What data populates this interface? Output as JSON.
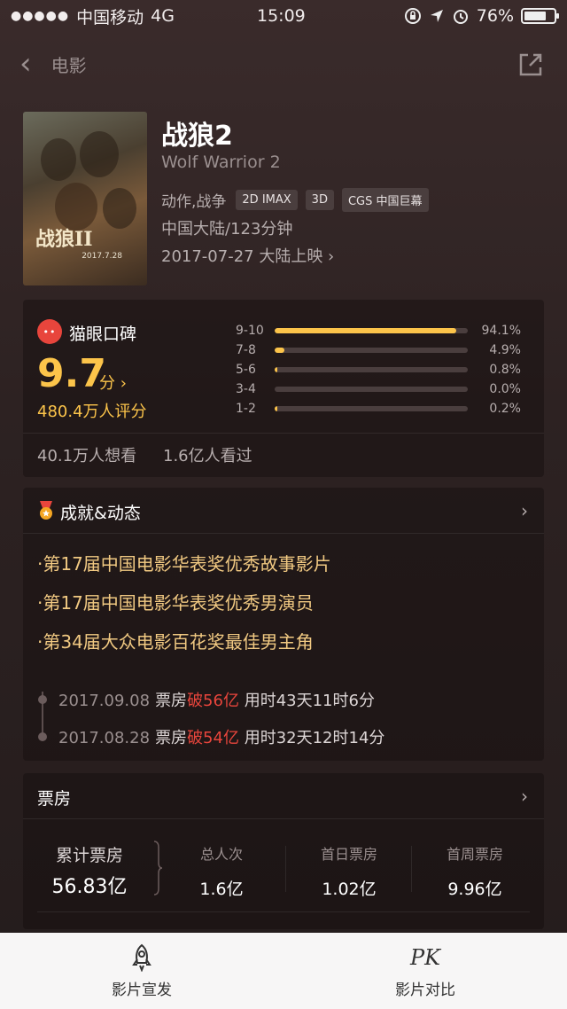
{
  "status_bar": {
    "carrier": "中国移动",
    "network": "4G",
    "time": "15:09",
    "battery": "76%",
    "battery_level": 0.76
  },
  "nav": {
    "back_icon": "chevron-left-icon",
    "title": "电影",
    "share_icon": "share-icon"
  },
  "movie": {
    "title": "战狼2",
    "english_title": "Wolf Warrior 2",
    "genre": "动作,战争",
    "tags": [
      "2D IMAX",
      "3D",
      "CGS 中国巨幕"
    ],
    "region_duration": "中国大陆/123分钟",
    "release": "2017-07-27 大陆上映 ›",
    "poster": {
      "title": "战狼II",
      "date": "2017.7.28"
    }
  },
  "rating": {
    "brand": "猫眼口碑",
    "score": "9.7",
    "score_unit": "分 ›",
    "count": "480.4万人评分",
    "distribution": [
      {
        "label": "9-10",
        "pct": "94.1%",
        "value": 94.1
      },
      {
        "label": "7-8",
        "pct": "4.9%",
        "value": 4.9
      },
      {
        "label": "5-6",
        "pct": "0.8%",
        "value": 0.8
      },
      {
        "label": "3-4",
        "pct": "0.0%",
        "value": 0.0
      },
      {
        "label": "1-2",
        "pct": "0.2%",
        "value": 0.2
      }
    ],
    "want_to_watch": "40.1万人想看",
    "watched": "1.6亿人看过"
  },
  "achievements": {
    "title": "成就&动态",
    "awards": [
      "·第17届中国电影华表奖优秀故事影片",
      "·第17届中国电影华表奖优秀男演员",
      "·第34届大众电影百花奖最佳男主角"
    ],
    "timeline": [
      {
        "date": "2017.09.08",
        "prefix": "票房",
        "highlight": "破56亿",
        "suffix": " 用时43天11时6分"
      },
      {
        "date": "2017.08.28",
        "prefix": "票房",
        "highlight": "破54亿",
        "suffix": " 用时32天12时14分"
      }
    ]
  },
  "box_office": {
    "title": "票房",
    "total_label": "累计票房",
    "total_value": "56.83亿",
    "stats": [
      {
        "label": "总人次",
        "value": "1.6亿"
      },
      {
        "label": "首日票房",
        "value": "1.02亿"
      },
      {
        "label": "首周票房",
        "value": "9.96亿"
      }
    ]
  },
  "tabbar": {
    "promo_label": "影片宣发",
    "compare_label": "影片对比",
    "compare_glyph": "PK"
  },
  "colors": {
    "accent_yellow": "#fcc44a",
    "accent_red": "#e8453c",
    "award_gold": "#f1c982"
  }
}
